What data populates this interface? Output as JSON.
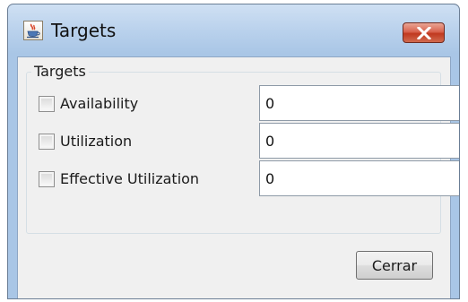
{
  "window": {
    "title": "Targets",
    "app_icon": "java-cup-icon",
    "close_icon": "close-icon"
  },
  "group": {
    "title": "Targets"
  },
  "rows": [
    {
      "label": "Availability",
      "checked": false,
      "value": "0"
    },
    {
      "label": "Utilization",
      "checked": false,
      "value": "0"
    },
    {
      "label": "Effective Utilization",
      "checked": false,
      "value": "0"
    }
  ],
  "buttons": {
    "close_label": "Cerrar"
  },
  "colors": {
    "titlebar": "#b9d1ec",
    "close_button": "#c0391f",
    "client_background": "#f0f0f0"
  }
}
